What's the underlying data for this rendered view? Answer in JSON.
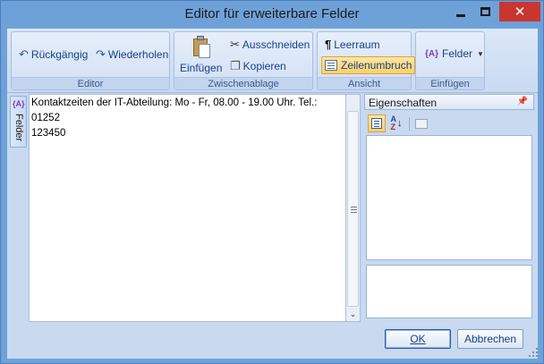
{
  "window": {
    "title": "Editor für erweiterbare Felder",
    "accent": "#6fa1d9",
    "close_color": "#c7372f",
    "minimize_icon": "minimize-icon",
    "maximize_icon": "maximize-icon",
    "close_icon": "close-icon"
  },
  "ribbon": {
    "groups": {
      "editor": {
        "label": "Editor",
        "undo": "Rückgängig",
        "redo": "Wiederholen"
      },
      "clipboard": {
        "label": "Zwischenablage",
        "paste": "Einfügen",
        "cut": "Ausschneiden",
        "copy": "Kopieren"
      },
      "view": {
        "label": "Ansicht",
        "whitespace": "Leerraum",
        "wordwrap": "Zeilenumbruch",
        "wordwrap_active": true
      },
      "insert": {
        "label": "Einfügen",
        "fields": "Felder"
      }
    }
  },
  "sidetab": {
    "icon_text": "{A}",
    "label": "Felder"
  },
  "editor": {
    "lines": [
      "Kontaktzeiten der IT-Abteilung: Mo - Fr, 08.00 - 19.00 Uhr. Tel.: 01252",
      "123450"
    ]
  },
  "properties": {
    "title": "Eigenschaften",
    "pin_icon": "pin-icon",
    "toolbar": [
      "categorized-icon",
      "alphabetical-sort-icon",
      "property-pages-icon"
    ],
    "az_label_a": "A",
    "az_label_z": "Z"
  },
  "footer": {
    "ok": "OK",
    "cancel": "Abbrechen"
  }
}
